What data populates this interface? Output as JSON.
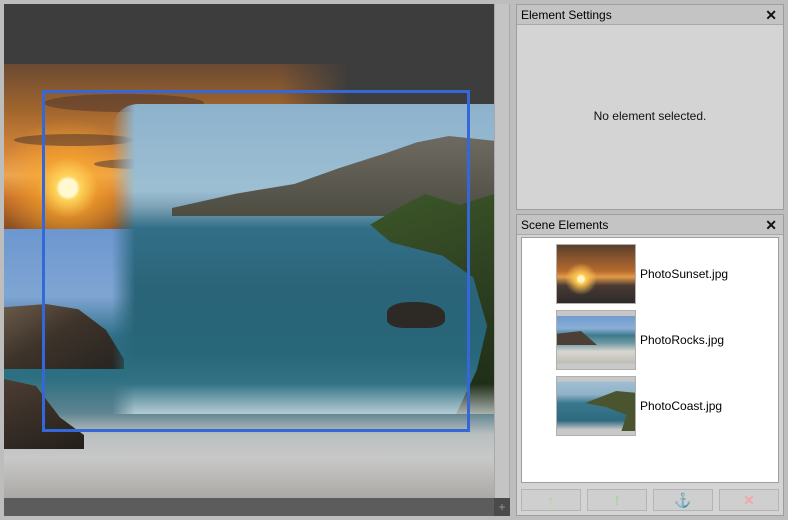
{
  "element_settings": {
    "title": "Element Settings",
    "close_glyph": "✕",
    "empty_message": "No element selected."
  },
  "scene_elements": {
    "title": "Scene Elements",
    "close_glyph": "✕",
    "items": [
      {
        "label": "PhotoSunset.jpg",
        "thumbnail": "sunset"
      },
      {
        "label": "PhotoRocks.jpg",
        "thumbnail": "rocks"
      },
      {
        "label": "PhotoCoast.jpg",
        "thumbnail": "coast"
      }
    ],
    "toolbar": {
      "move_up_glyph": "↑",
      "move_down_glyph": "!",
      "anchor_glyph": "⚓",
      "delete_glyph": "✕"
    }
  },
  "canvas": {
    "corner_glyph": "+",
    "selection_color": "#3467d8"
  },
  "icons": {
    "panel_close": "close-icon",
    "move_up": "arrow-up-icon",
    "move_down": "arrow-down-icon",
    "anchor": "anchor-icon",
    "delete": "delete-icon"
  }
}
